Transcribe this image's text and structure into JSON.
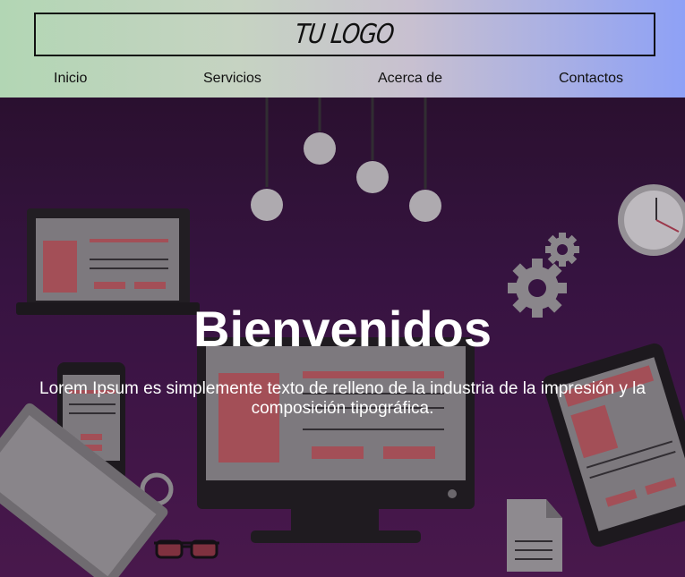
{
  "logo": {
    "text": "TU LOGO"
  },
  "nav": {
    "items": [
      "Inicio",
      "Servicios",
      "Acerca de",
      "Contactos"
    ]
  },
  "hero": {
    "title": "Bienvenidos",
    "text": "Lorem Ipsum es simplemente texto de relleno de la industria de la impresión y la composición tipográfica."
  },
  "colors": {
    "header_gradient_start": "#b2d6b4",
    "header_gradient_end": "#8ea1f6",
    "hero_background": "#3a1545",
    "hero_text": "#ffffff"
  }
}
